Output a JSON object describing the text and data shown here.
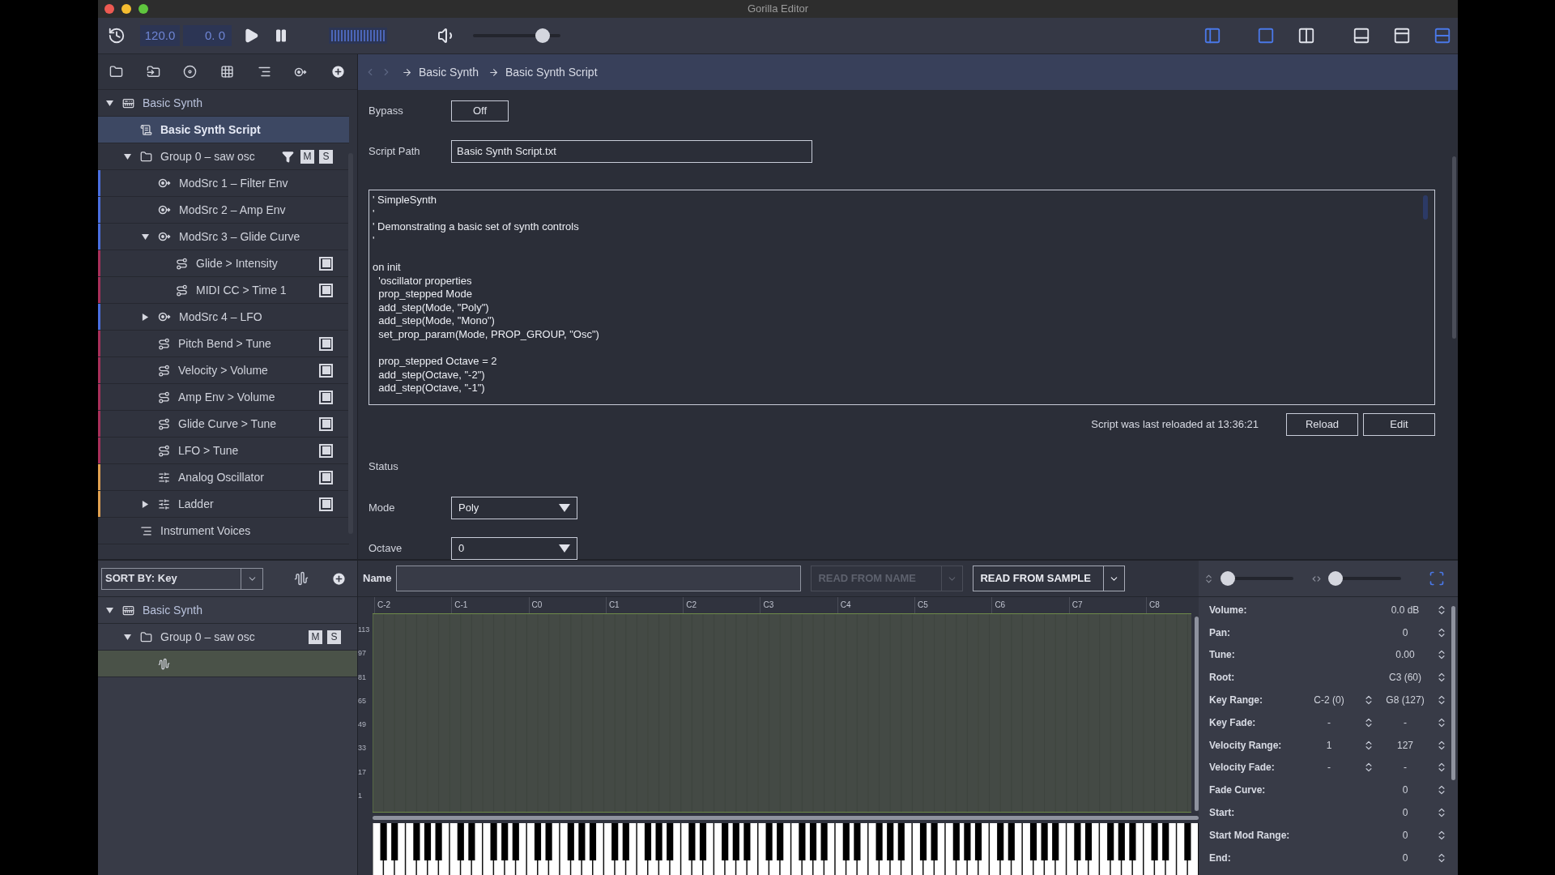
{
  "window": {
    "title": "Gorilla Editor"
  },
  "transport": {
    "tempo": "120.0",
    "position": "0. 0",
    "volume": {
      "level": 0.85
    }
  },
  "layout_buttons": [
    {
      "active": true
    },
    {
      "active": true
    },
    {
      "active": false
    },
    {
      "active": false
    },
    {
      "active": false
    },
    {
      "active": true
    }
  ],
  "tree": [
    {
      "label": "Basic Synth",
      "kind": "instrument",
      "expanded": true,
      "selected": false,
      "children": [
        {
          "label": "Basic Synth Script",
          "kind": "script",
          "selected": true
        },
        {
          "label": "Group 0 – saw osc",
          "kind": "group",
          "expanded": true,
          "selected": false,
          "mute": "M",
          "solo": "S",
          "children": [
            {
              "label": "ModSrc 1 – Filter Env",
              "kind": "modsrc",
              "color": "#4a6fe0",
              "selected": false
            },
            {
              "label": "ModSrc 2 – Amp Env",
              "kind": "modsrc",
              "color": "#4a6fe0",
              "selected": false
            },
            {
              "label": "ModSrc 3 – Glide Curve",
              "kind": "modsrc",
              "color": "#4a6fe0",
              "expanded": true,
              "selected": false,
              "children": [
                {
                  "label": "Glide > Intensity",
                  "kind": "modulation",
                  "color": "#a8305a",
                  "enabled": true,
                  "selected": false
                },
                {
                  "label": "MIDI CC > Time 1",
                  "kind": "modulation",
                  "color": "#a8305a",
                  "enabled": true,
                  "selected": false
                }
              ]
            },
            {
              "label": "ModSrc 4 – LFO",
              "kind": "modsrc",
              "color": "#4a6fe0",
              "expanded": false,
              "selected": false
            },
            {
              "label": "Pitch Bend > Tune",
              "kind": "modulation",
              "color": "#a8305a",
              "enabled": true,
              "selected": false
            },
            {
              "label": "Velocity > Volume",
              "kind": "modulation",
              "color": "#a8305a",
              "enabled": true,
              "selected": false
            },
            {
              "label": "Amp Env > Volume",
              "kind": "modulation",
              "color": "#a8305a",
              "enabled": true,
              "selected": false
            },
            {
              "label": "Glide Curve > Tune",
              "kind": "modulation",
              "color": "#a8305a",
              "enabled": true,
              "selected": false
            },
            {
              "label": "LFO > Tune",
              "kind": "modulation",
              "color": "#a8305a",
              "enabled": true,
              "selected": false
            },
            {
              "label": "Analog Oscillator",
              "kind": "effect",
              "color": "#e0a050",
              "enabled": true,
              "selected": false
            },
            {
              "label": "Ladder",
              "kind": "effect",
              "color": "#e0a050",
              "expanded": false,
              "enabled": true,
              "selected": false
            }
          ]
        },
        {
          "label": "Instrument Voices",
          "kind": "voices",
          "selected": false
        }
      ]
    }
  ],
  "breadcrumb": [
    "Basic Synth",
    "Basic Synth Script"
  ],
  "bypass": {
    "label": "Bypass",
    "value": "Off"
  },
  "script_path": {
    "label": "Script Path",
    "value": "Basic Synth Script.txt"
  },
  "script": "' SimpleSynth\n'\n' Demonstrating a basic set of synth controls\n'\n\non init\n  'oscillator properties\n  prop_stepped Mode\n  add_step(Mode, \"Poly\")\n  add_step(Mode, \"Mono\")\n  set_prop_param(Mode, PROP_GROUP, \"Osc\")\n\n  prop_stepped Octave = 2\n  add_step(Octave, \"-2\")\n  add_step(Octave, \"-1\")",
  "reload_status": "Script was last reloaded at 13:36:21",
  "script_buttons": [
    "Reload",
    "Edit"
  ],
  "status_label": "Status",
  "script_properties": [
    {
      "label": "Mode",
      "value": "Poly"
    },
    {
      "label": "Octave",
      "value": "0"
    }
  ],
  "sort": {
    "label": "SORT BY: Key"
  },
  "samples_tree": [
    {
      "label": "Basic Synth",
      "kind": "instrument",
      "expanded": true,
      "selected": false,
      "children": [
        {
          "label": "Group 0 – saw osc",
          "kind": "group",
          "expanded": true,
          "selected": false,
          "mute": "M",
          "solo": "S",
          "children": [
            {
              "kind": "sample",
              "selected": true
            }
          ]
        }
      ]
    }
  ],
  "name_field": {
    "label": "Name"
  },
  "read_buttons": [
    {
      "label": "READ FROM NAME",
      "disabled": true
    },
    {
      "label": "READ FROM SAMPLE",
      "disabled": false
    }
  ],
  "zoom_sliders": [
    {
      "level": 0
    },
    {
      "level": 0
    }
  ],
  "key_labels": [
    "C-2",
    "C-1",
    "C0",
    "C1",
    "C2",
    "C3",
    "C4",
    "C5",
    "C6",
    "C7",
    "C8"
  ],
  "velocity_labels": [
    "113",
    "97",
    "81",
    "65",
    "49",
    "33",
    "17",
    "1"
  ],
  "zone_properties": [
    {
      "label": "Volume:",
      "value": "0.0 dB"
    },
    {
      "label": "Pan:",
      "value": "0"
    },
    {
      "label": "Tune:",
      "value": "0.00"
    },
    {
      "label": "Root:",
      "value": "C3 (60)"
    },
    {
      "label": "Key Range:",
      "value": "C-2 (0)",
      "value_2": "G8 (127)"
    },
    {
      "label": "Key Fade:",
      "value": "-",
      "value_2": "-"
    },
    {
      "label": "Velocity Range:",
      "value": "1",
      "value_2": "127"
    },
    {
      "label": "Velocity Fade:",
      "value": "-",
      "value_2": "-"
    },
    {
      "label": "Fade Curve:",
      "value": "0"
    },
    {
      "label": "Start:",
      "value": "0"
    },
    {
      "label": "Start Mod Range:",
      "value": "0"
    },
    {
      "label": "End:",
      "value": "0"
    }
  ]
}
